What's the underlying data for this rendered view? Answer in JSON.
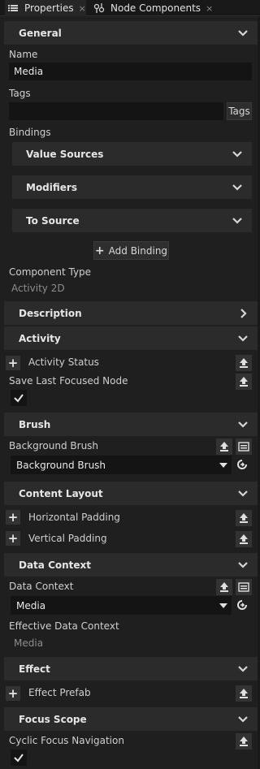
{
  "tabs": [
    {
      "label": "Properties",
      "close": "×"
    },
    {
      "label": "Node Components",
      "close": "×"
    }
  ],
  "general": {
    "title": "General",
    "name_label": "Name",
    "name_value": "Media",
    "tags_label": "Tags",
    "tags_value": "",
    "tags_button": "Tags",
    "bindings_label": "Bindings",
    "value_sources": "Value Sources",
    "modifiers": "Modifiers",
    "to_source": "To Source",
    "add_binding": "Add Binding",
    "component_type_label": "Component Type",
    "component_type_value": "Activity 2D"
  },
  "description": {
    "title": "Description"
  },
  "activity": {
    "title": "Activity",
    "activity_status": "Activity Status",
    "save_last_focused": "Save Last Focused Node",
    "save_last_focused_checked": true
  },
  "brush": {
    "title": "Brush",
    "background_brush_label": "Background Brush",
    "background_brush_value": "Background Brush"
  },
  "content_layout": {
    "title": "Content Layout",
    "horizontal_padding": "Horizontal Padding",
    "vertical_padding": "Vertical Padding"
  },
  "data_context": {
    "title": "Data Context",
    "data_context_label": "Data Context",
    "data_context_value": "Media",
    "effective_label": "Effective Data Context",
    "effective_value": "Media"
  },
  "effect": {
    "title": "Effect",
    "effect_prefab": "Effect Prefab"
  },
  "focus_scope": {
    "title": "Focus Scope",
    "cyclic_focus": "Cyclic Focus Navigation",
    "cyclic_focus_checked": true
  },
  "icons": {
    "tab_properties": "list-icon",
    "tab_components": "components-icon",
    "expand": "chevron-down-icon",
    "collapse": "chevron-right-icon",
    "add": "plus-icon",
    "reset": "upload-icon",
    "binding": "binding-icon",
    "dropdown": "dropdown-arrow-icon",
    "revert": "revert-icon",
    "check": "checkmark-icon"
  }
}
